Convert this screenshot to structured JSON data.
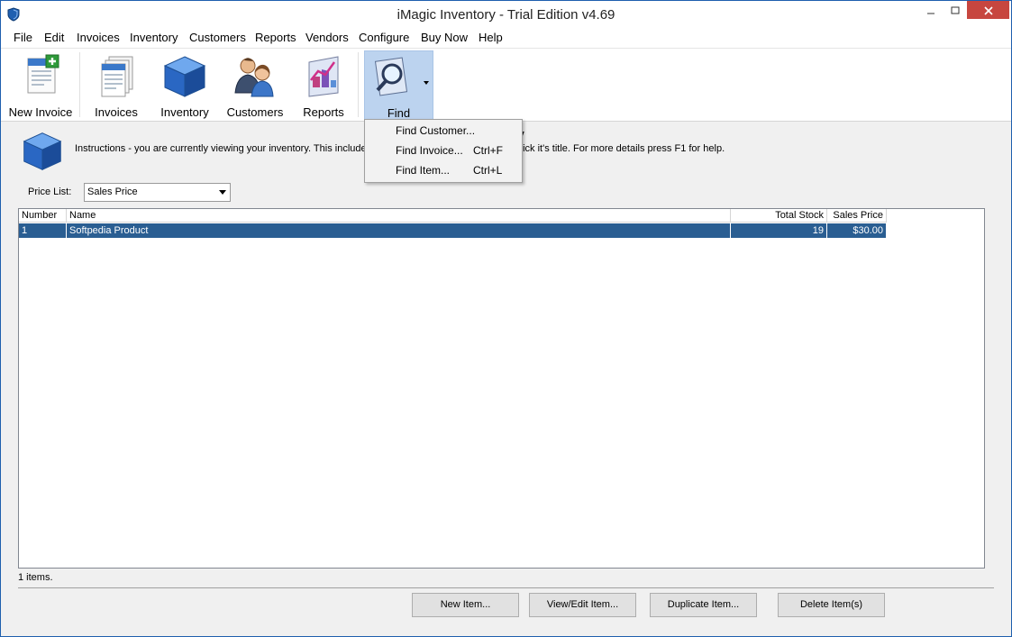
{
  "window": {
    "title": "iMagic Inventory - Trial Edition v4.69"
  },
  "menu": {
    "items": [
      "File",
      "Edit",
      "Invoices",
      "Inventory",
      "Customers",
      "Reports",
      "Vendors",
      "Configure",
      "Buy Now",
      "Help"
    ]
  },
  "toolbar": {
    "new_invoice": "New Invoice",
    "invoices": "Invoices",
    "inventory": "Inventory",
    "customers": "Customers",
    "reports": "Reports",
    "find": "Find"
  },
  "find_menu": {
    "items": [
      {
        "label": "Find Customer...",
        "shortcut": ""
      },
      {
        "label": "Find Invoice...",
        "shortcut": "Ctrl+F"
      },
      {
        "label": "Find Item...",
        "shortcut": "Ctrl+L"
      }
    ]
  },
  "instructions": {
    "title_fragment": "tory",
    "text_left": "Instructions - you are currently viewing your inventory. This includes",
    "text_right": "n click it's title. For more details press F1 for help."
  },
  "price_list": {
    "label": "Price List:",
    "value": "Sales Price"
  },
  "table": {
    "headers": {
      "number": "Number",
      "name": "Name",
      "total_stock": "Total Stock",
      "sales_price": "Sales Price"
    },
    "rows": [
      {
        "number": "1",
        "name": "Softpedia Product",
        "total_stock": "19",
        "sales_price": "$30.00"
      }
    ]
  },
  "status": {
    "count": "1 items."
  },
  "buttons": {
    "new_item": "New Item...",
    "view_edit_item": "View/Edit Item...",
    "duplicate_item": "Duplicate Item...",
    "delete_items": "Delete Item(s)"
  },
  "colors": {
    "selected_row": "#2a5e92",
    "close_button": "#c7463f",
    "find_highlight": "#bcd3ef"
  }
}
